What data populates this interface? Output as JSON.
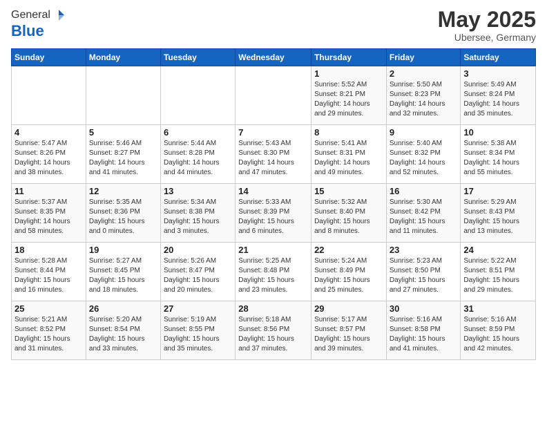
{
  "logo": {
    "general": "General",
    "blue": "Blue"
  },
  "header": {
    "month": "May 2025",
    "location": "Ubersee, Germany"
  },
  "days_of_week": [
    "Sunday",
    "Monday",
    "Tuesday",
    "Wednesday",
    "Thursday",
    "Friday",
    "Saturday"
  ],
  "weeks": [
    [
      {
        "day": "",
        "info": ""
      },
      {
        "day": "",
        "info": ""
      },
      {
        "day": "",
        "info": ""
      },
      {
        "day": "",
        "info": ""
      },
      {
        "day": "1",
        "info": "Sunrise: 5:52 AM\nSunset: 8:21 PM\nDaylight: 14 hours\nand 29 minutes."
      },
      {
        "day": "2",
        "info": "Sunrise: 5:50 AM\nSunset: 8:23 PM\nDaylight: 14 hours\nand 32 minutes."
      },
      {
        "day": "3",
        "info": "Sunrise: 5:49 AM\nSunset: 8:24 PM\nDaylight: 14 hours\nand 35 minutes."
      }
    ],
    [
      {
        "day": "4",
        "info": "Sunrise: 5:47 AM\nSunset: 8:26 PM\nDaylight: 14 hours\nand 38 minutes."
      },
      {
        "day": "5",
        "info": "Sunrise: 5:46 AM\nSunset: 8:27 PM\nDaylight: 14 hours\nand 41 minutes."
      },
      {
        "day": "6",
        "info": "Sunrise: 5:44 AM\nSunset: 8:28 PM\nDaylight: 14 hours\nand 44 minutes."
      },
      {
        "day": "7",
        "info": "Sunrise: 5:43 AM\nSunset: 8:30 PM\nDaylight: 14 hours\nand 47 minutes."
      },
      {
        "day": "8",
        "info": "Sunrise: 5:41 AM\nSunset: 8:31 PM\nDaylight: 14 hours\nand 49 minutes."
      },
      {
        "day": "9",
        "info": "Sunrise: 5:40 AM\nSunset: 8:32 PM\nDaylight: 14 hours\nand 52 minutes."
      },
      {
        "day": "10",
        "info": "Sunrise: 5:38 AM\nSunset: 8:34 PM\nDaylight: 14 hours\nand 55 minutes."
      }
    ],
    [
      {
        "day": "11",
        "info": "Sunrise: 5:37 AM\nSunset: 8:35 PM\nDaylight: 14 hours\nand 58 minutes."
      },
      {
        "day": "12",
        "info": "Sunrise: 5:35 AM\nSunset: 8:36 PM\nDaylight: 15 hours\nand 0 minutes."
      },
      {
        "day": "13",
        "info": "Sunrise: 5:34 AM\nSunset: 8:38 PM\nDaylight: 15 hours\nand 3 minutes."
      },
      {
        "day": "14",
        "info": "Sunrise: 5:33 AM\nSunset: 8:39 PM\nDaylight: 15 hours\nand 6 minutes."
      },
      {
        "day": "15",
        "info": "Sunrise: 5:32 AM\nSunset: 8:40 PM\nDaylight: 15 hours\nand 8 minutes."
      },
      {
        "day": "16",
        "info": "Sunrise: 5:30 AM\nSunset: 8:42 PM\nDaylight: 15 hours\nand 11 minutes."
      },
      {
        "day": "17",
        "info": "Sunrise: 5:29 AM\nSunset: 8:43 PM\nDaylight: 15 hours\nand 13 minutes."
      }
    ],
    [
      {
        "day": "18",
        "info": "Sunrise: 5:28 AM\nSunset: 8:44 PM\nDaylight: 15 hours\nand 16 minutes."
      },
      {
        "day": "19",
        "info": "Sunrise: 5:27 AM\nSunset: 8:45 PM\nDaylight: 15 hours\nand 18 minutes."
      },
      {
        "day": "20",
        "info": "Sunrise: 5:26 AM\nSunset: 8:47 PM\nDaylight: 15 hours\nand 20 minutes."
      },
      {
        "day": "21",
        "info": "Sunrise: 5:25 AM\nSunset: 8:48 PM\nDaylight: 15 hours\nand 23 minutes."
      },
      {
        "day": "22",
        "info": "Sunrise: 5:24 AM\nSunset: 8:49 PM\nDaylight: 15 hours\nand 25 minutes."
      },
      {
        "day": "23",
        "info": "Sunrise: 5:23 AM\nSunset: 8:50 PM\nDaylight: 15 hours\nand 27 minutes."
      },
      {
        "day": "24",
        "info": "Sunrise: 5:22 AM\nSunset: 8:51 PM\nDaylight: 15 hours\nand 29 minutes."
      }
    ],
    [
      {
        "day": "25",
        "info": "Sunrise: 5:21 AM\nSunset: 8:52 PM\nDaylight: 15 hours\nand 31 minutes."
      },
      {
        "day": "26",
        "info": "Sunrise: 5:20 AM\nSunset: 8:54 PM\nDaylight: 15 hours\nand 33 minutes."
      },
      {
        "day": "27",
        "info": "Sunrise: 5:19 AM\nSunset: 8:55 PM\nDaylight: 15 hours\nand 35 minutes."
      },
      {
        "day": "28",
        "info": "Sunrise: 5:18 AM\nSunset: 8:56 PM\nDaylight: 15 hours\nand 37 minutes."
      },
      {
        "day": "29",
        "info": "Sunrise: 5:17 AM\nSunset: 8:57 PM\nDaylight: 15 hours\nand 39 minutes."
      },
      {
        "day": "30",
        "info": "Sunrise: 5:16 AM\nSunset: 8:58 PM\nDaylight: 15 hours\nand 41 minutes."
      },
      {
        "day": "31",
        "info": "Sunrise: 5:16 AM\nSunset: 8:59 PM\nDaylight: 15 hours\nand 42 minutes."
      }
    ]
  ]
}
